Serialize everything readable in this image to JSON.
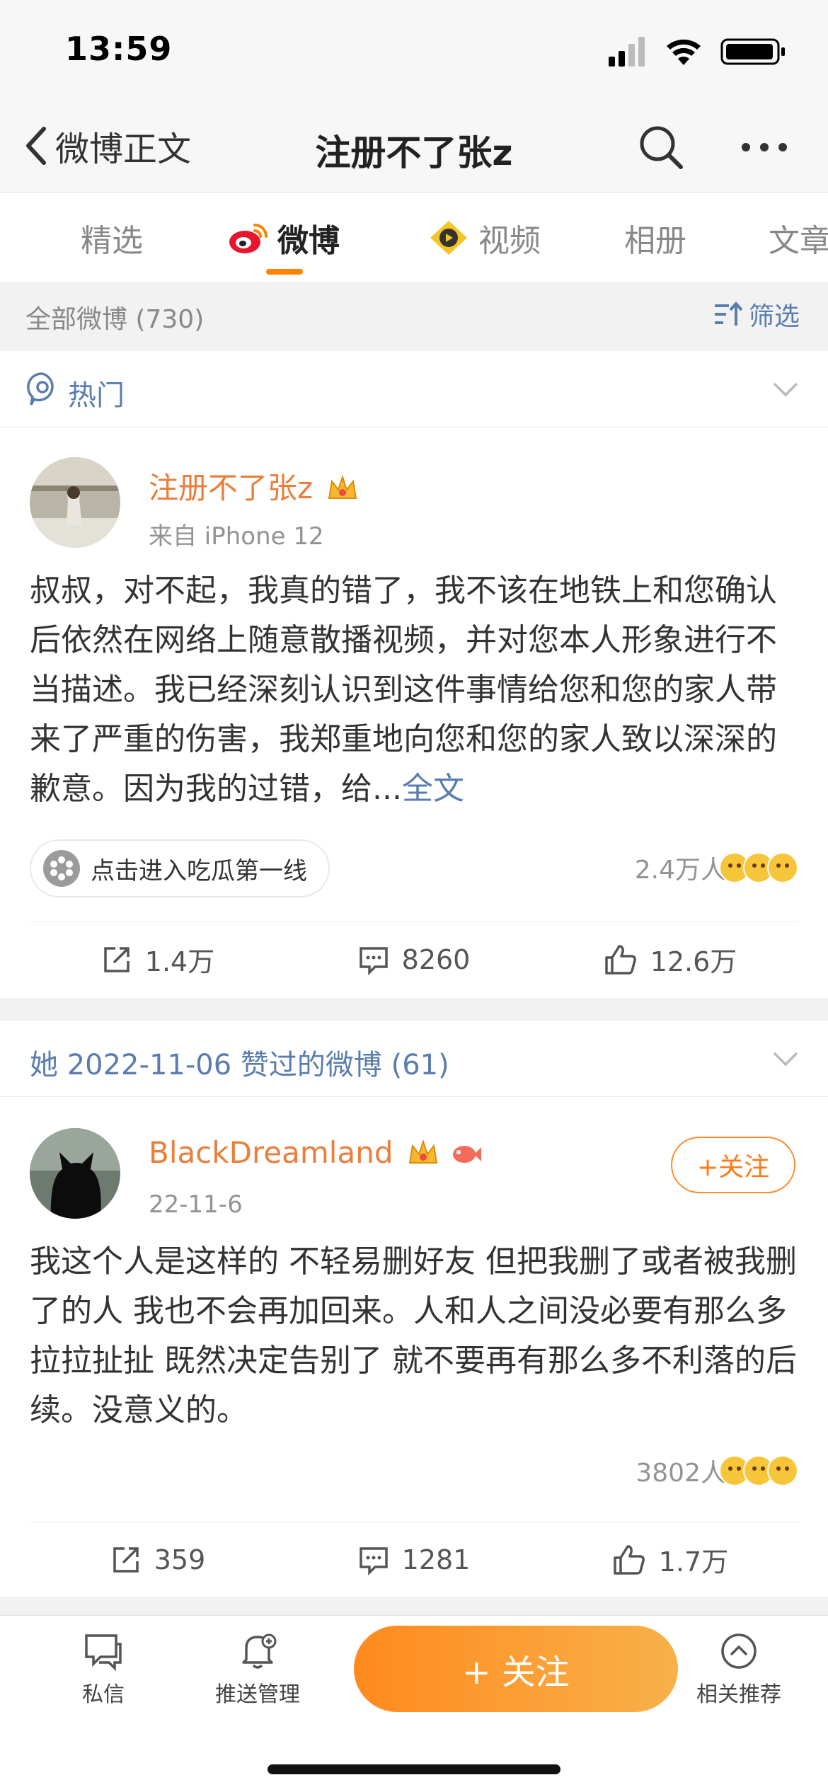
{
  "status": {
    "time": "13:59"
  },
  "nav": {
    "back_label": "微博正文",
    "title": "注册不了张z"
  },
  "tabs": [
    {
      "label": "精选"
    },
    {
      "label": "微博"
    },
    {
      "label": "视频"
    },
    {
      "label": "相册"
    },
    {
      "label": "文章"
    }
  ],
  "filter": {
    "count_label": "全部微博 (730)",
    "filter_label": "筛选"
  },
  "hot_section": {
    "title": "热门"
  },
  "post1": {
    "username": "注册不了张z",
    "source": "来自 iPhone 12",
    "text": "叔叔，对不起，我真的错了，我不该在地铁上和您确认后依然在网络上随意散播视频，并对您本人形象进行不当描述。我已经深刻认识到这件事情给您和您的家人带来了严重的伤害，我郑重地向您和您的家人致以深深的歉意。因为我的过错，给...",
    "fulltext_label": "全文",
    "topic_label": "点击进入吃瓜第一线",
    "reaction_count": "2.4万人",
    "repost": "1.4万",
    "comment": "8260",
    "like": "12.6万"
  },
  "liked_section": {
    "title": "她 2022-11-06 赞过的微博 (61)"
  },
  "post2": {
    "username": "BlackDreamland",
    "date": "22-11-6",
    "follow_label": "+关注",
    "text": "我这个人是这样的 不轻易删好友 但把我删了或者被我删了的人 我也不会再加回来。人和人之间没必要有那么多拉拉扯扯 既然决定告别了 就不要再有那么多不利落的后续。没意义的。",
    "reaction_count": "3802人",
    "repost": "359",
    "comment": "1281",
    "like": "1.7万"
  },
  "bottom": {
    "messages_label": "私信",
    "push_label": "推送管理",
    "follow_label": "+ 关注",
    "related_label": "相关推荐"
  },
  "colors": {
    "accent": "#ff8200",
    "link": "#5a7dae",
    "username": "#ea7e3a"
  }
}
